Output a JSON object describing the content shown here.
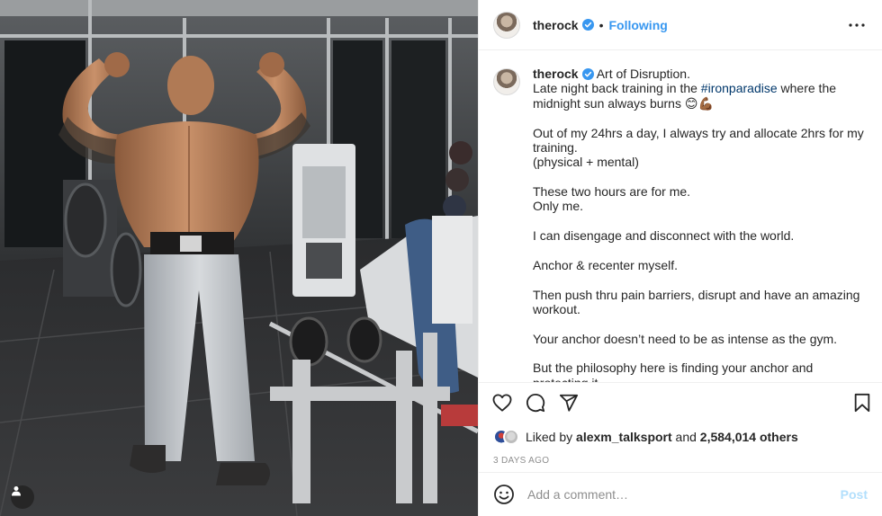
{
  "post": {
    "username": "therock",
    "follow_status": "Following",
    "caption": {
      "username": "therock",
      "lines": [
        {
          "text": " Art of Disruption."
        },
        {
          "text": "Late night back training in the ",
          "hashtag": "#ironparadise",
          "after": " where the midnight sun always burns 😊💪🏾"
        },
        {
          "text": ""
        },
        {
          "text": "Out of my 24hrs a day, I always try and allocate 2hrs for my training."
        },
        {
          "text": "(physical + mental)"
        },
        {
          "text": ""
        },
        {
          "text": "These two hours are for me."
        },
        {
          "text": "Only me."
        },
        {
          "text": ""
        },
        {
          "text": "I can disengage and disconnect with the world."
        },
        {
          "text": ""
        },
        {
          "text": "Anchor & recenter myself."
        },
        {
          "text": ""
        },
        {
          "text": "Then push thru pain barriers, disrupt and have an amazing workout."
        },
        {
          "text": ""
        },
        {
          "text": "Your anchor doesn’t need to be as intense as the gym."
        },
        {
          "text": ""
        },
        {
          "text": "But the philosophy here is finding your anchor and protecting it."
        }
      ]
    },
    "likes": {
      "prefix": "Liked by ",
      "liker": "alexm_talksport",
      "middle": " and ",
      "count": "2,584,014 others"
    },
    "timestamp": "3 DAYS AGO",
    "comment_box": {
      "placeholder": "Add a comment…",
      "post_label": "Post"
    },
    "icons": {
      "verified": "verified-badge-icon",
      "more": "more-options-icon",
      "like": "heart-icon",
      "comment": "comment-bubble-icon",
      "share": "paper-plane-icon",
      "save": "bookmark-icon",
      "emoji": "emoji-icon",
      "tags": "user-tag-icon"
    },
    "colors": {
      "link_blue": "#3797f0",
      "hashtag": "#00376b",
      "post_disabled": "#b2dffc",
      "muted": "#8e8e8e"
    }
  }
}
